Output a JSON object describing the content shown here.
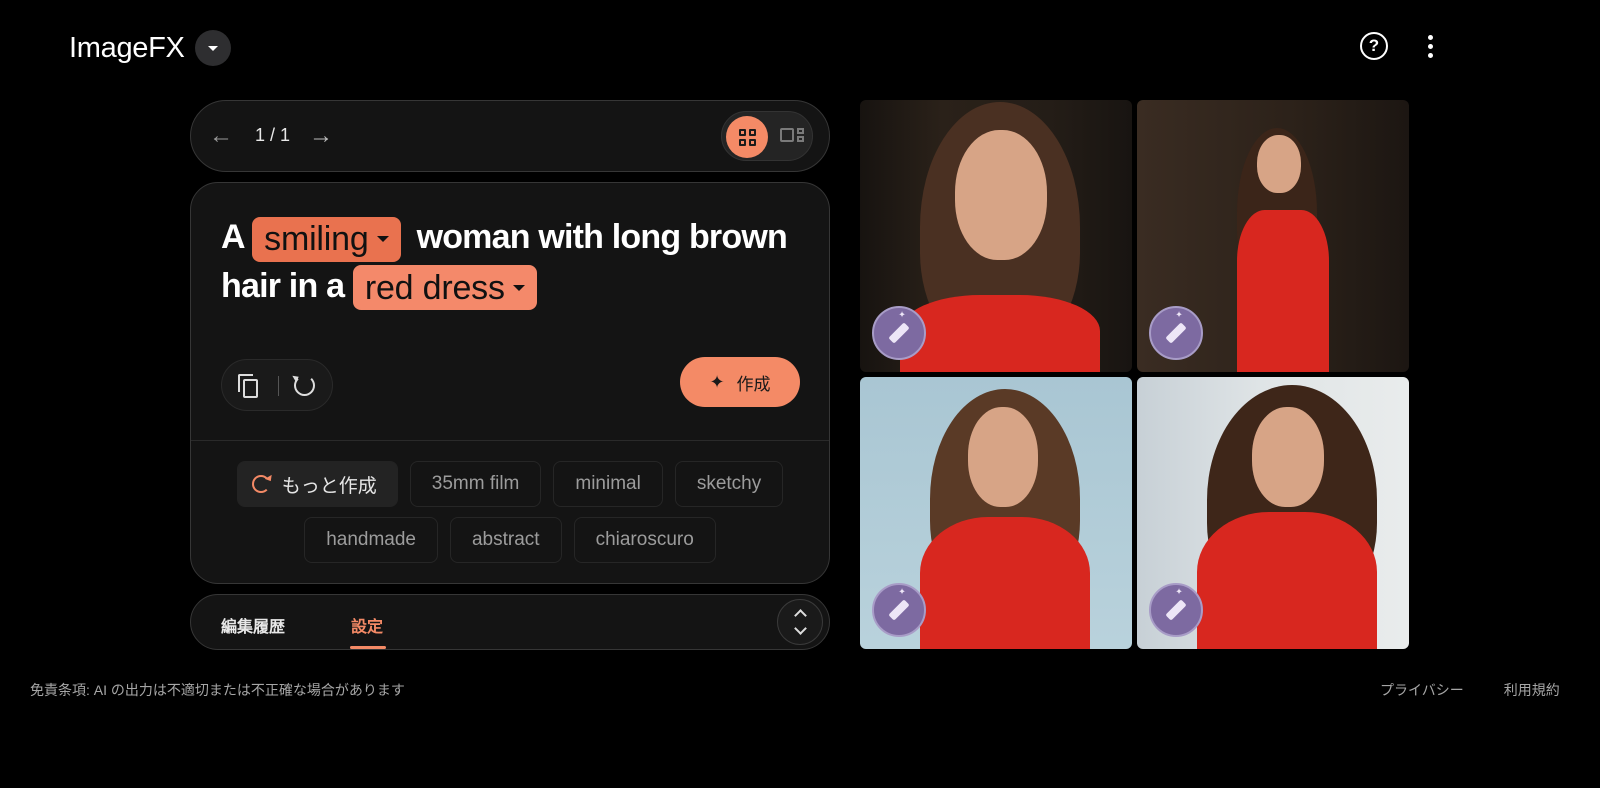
{
  "header": {
    "app_title": "ImageFX",
    "icons": [
      "chevron-down-icon",
      "help-icon",
      "more-vert-icon"
    ]
  },
  "pager": {
    "page_label": "1 / 1",
    "view_modes": [
      "grid-view",
      "single-view"
    ],
    "active_view": "grid-view"
  },
  "prompt": {
    "word_a": "A",
    "chip_1": "smiling",
    "middle": "woman with long brown",
    "line2_start": "hair in a",
    "chip_2": "red dress",
    "create_label": "作成"
  },
  "suggestions": {
    "more_label": "もっと作成",
    "row1": [
      "35mm film",
      "minimal",
      "sketchy"
    ],
    "row2": [
      "handmade",
      "abstract",
      "chiaroscuro"
    ]
  },
  "tabs": {
    "history": "編集履歴",
    "settings": "設定",
    "active": "settings"
  },
  "footer": {
    "disclaimer": "免責条項: AI の出力は不適切または不正確な場合があります",
    "privacy": "プライバシー",
    "terms": "利用規約"
  },
  "colors": {
    "accent": "#f48a66",
    "chip": "#e9724f",
    "background": "#000000",
    "panel": "#141414",
    "edit_fab": "#7d6aa1"
  }
}
